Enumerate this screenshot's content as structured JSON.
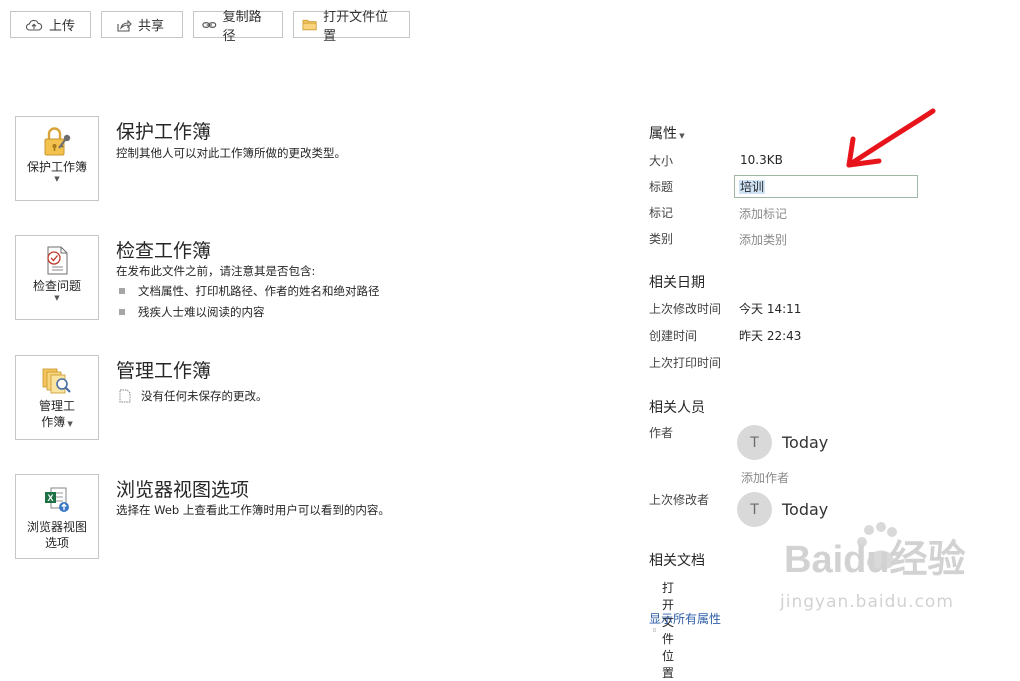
{
  "toolbar": {
    "upload": "上传",
    "share": "共享",
    "copy_path": "复制路径",
    "open_location": "打开文件位置"
  },
  "sections": {
    "protect": {
      "button": "保护工作簿",
      "title": "保护工作簿",
      "desc": "控制其他人可以对此工作簿所做的更改类型。"
    },
    "inspect": {
      "button": "检查问题",
      "title": "检查工作簿",
      "desc": "在发布此文件之前，请注意其是否包含:",
      "bullets": [
        "文档属性、打印机路径、作者的姓名和绝对路径",
        "残疾人士难以阅读的内容"
      ]
    },
    "manage": {
      "button_line1": "管理工",
      "button_line2": "作簿",
      "title": "管理工作簿",
      "desc": "没有任何未保存的更改。"
    },
    "browser": {
      "button_line1": "浏览器视图",
      "button_line2": "选项",
      "title": "浏览器视图选项",
      "desc": "选择在 Web 上查看此工作簿时用户可以看到的内容。"
    }
  },
  "properties": {
    "header": "属性",
    "size_label": "大小",
    "size_value": "10.3KB",
    "title_label": "标题",
    "title_value": "培训",
    "tags_label": "标记",
    "tags_hint": "添加标记",
    "category_label": "类别",
    "category_hint": "添加类别"
  },
  "dates": {
    "header": "相关日期",
    "modified_label": "上次修改时间",
    "modified_value": "今天 14:11",
    "created_label": "创建时间",
    "created_value": "昨天 22:43",
    "printed_label": "上次打印时间"
  },
  "people": {
    "header": "相关人员",
    "author_label": "作者",
    "author_initial": "T",
    "author_name": "Today",
    "add_author": "添加作者",
    "modified_by_label": "上次修改者",
    "modified_by_initial": "T",
    "modified_by_name": "Today"
  },
  "documents": {
    "header": "相关文档",
    "open_location": "打开文件位置",
    "show_all": "显示所有属性"
  },
  "watermark": {
    "brand": "Baidu经验",
    "url": "jingyan.baidu.com"
  },
  "colors": {
    "link": "#2e5ea8",
    "annotation_arrow": "#e8141b",
    "selection": "#cfe3f7"
  }
}
